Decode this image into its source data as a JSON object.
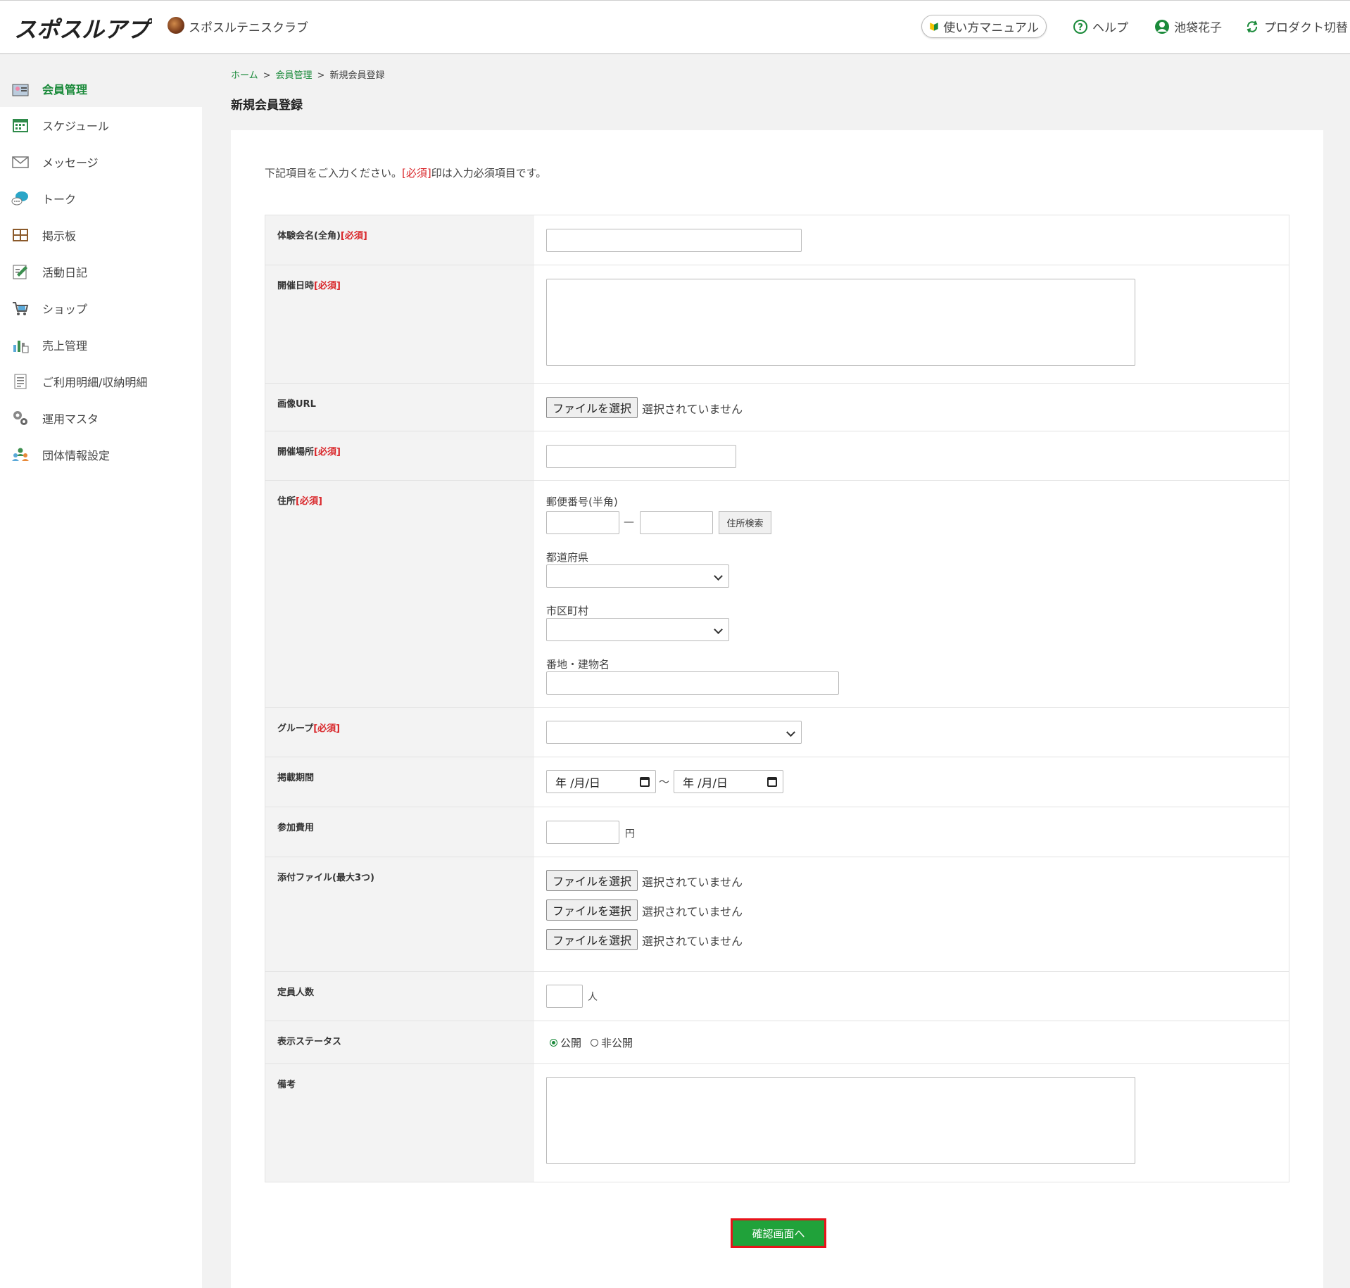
{
  "header": {
    "logo_text": "スポスルアプリ",
    "club_name": "スポスルテニスクラブ",
    "manual_label": "使い方マニュアル",
    "help_label": "ヘルプ",
    "user_name": "池袋花子",
    "product_switch_label": "プロダクト切替"
  },
  "sidebar": {
    "items": [
      {
        "label": "会員管理",
        "icon": "member-icon",
        "active": true
      },
      {
        "label": "スケジュール",
        "icon": "calendar-icon"
      },
      {
        "label": "メッセージ",
        "icon": "mail-icon"
      },
      {
        "label": "トーク",
        "icon": "chat-icon"
      },
      {
        "label": "掲示板",
        "icon": "board-icon"
      },
      {
        "label": "活動日記",
        "icon": "diary-icon"
      },
      {
        "label": "ショップ",
        "icon": "cart-icon"
      },
      {
        "label": "売上管理",
        "icon": "sales-icon"
      },
      {
        "label": "ご利用明細/収納明細",
        "icon": "statement-icon"
      },
      {
        "label": "運用マスタ",
        "icon": "gear-icon"
      },
      {
        "label": "団体情報設定",
        "icon": "group-icon"
      }
    ]
  },
  "breadcrumb": {
    "home": "ホーム",
    "members": "会員管理",
    "current": "新規会員登録",
    "separator": ">"
  },
  "page_title": "新規会員登録",
  "intro": {
    "before": "下記項目をご入力ください。",
    "required_mark": "[必須]",
    "after": "印は入力必須項目です。"
  },
  "required_mark": "[必須]",
  "form": {
    "event_name_label": "体験会名(全角)",
    "datetime_label": "開催日時",
    "image_url_label": "画像URL",
    "venue_label": "開催場所",
    "address_label": "住所",
    "postal_label": "郵便番号(半角)",
    "postal_dash": "—",
    "address_search_label": "住所検索",
    "prefecture_label": "都道府県",
    "city_label": "市区町村",
    "street_label": "番地・建物名",
    "group_label": "グループ",
    "period_label": "掲載期間",
    "date_placeholder": "年 /月/日",
    "period_tilde": "～",
    "fee_label": "参加費用",
    "fee_unit": "円",
    "attachment_label": "添付ファイル(最大3つ)",
    "capacity_label": "定員人数",
    "capacity_unit": "人",
    "status_label": "表示ステータス",
    "status_public": "公開",
    "status_private": "非公開",
    "notes_label": "備考",
    "file_button": "ファイルを選択",
    "file_status": "選択されていません"
  },
  "submit_label": "確認画面へ",
  "colors": {
    "accent": "#1a8a3a",
    "required": "#d9262a",
    "submit_bg": "#20a23a",
    "submit_border": "#e8131b"
  }
}
